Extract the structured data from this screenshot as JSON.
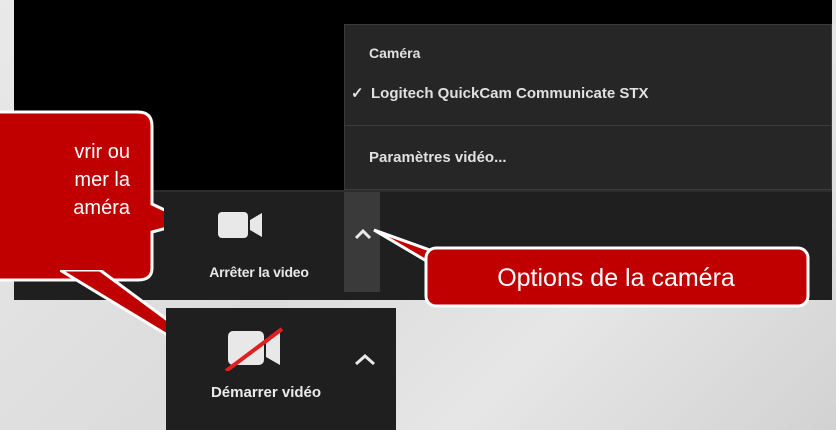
{
  "colors": {
    "callout_red": "#c00000",
    "callout_border": "#ffffff",
    "toolbar_bg": "#1f1f1f",
    "menu_bg": "#262626",
    "strike_red": "#e02020"
  },
  "menu": {
    "header": "Caméra",
    "items": [
      {
        "label": "Logitech QuickCam Communicate STX",
        "checked": true
      },
      {
        "label": "Paramètres vidéo..."
      }
    ],
    "check_glyph": "✓"
  },
  "toolbar": {
    "stop_video_label": "Arrêter la video",
    "camera_icon": "video-camera-icon",
    "options_icon": "chevron-up-icon"
  },
  "start_panel": {
    "label": "Démarrer vidéo",
    "camera_icon": "video-camera-off-icon",
    "options_icon": "chevron-up-icon"
  },
  "callouts": {
    "left_text": "vrir ou\nmer la\naméra",
    "right_text": "Options de la caméra"
  }
}
